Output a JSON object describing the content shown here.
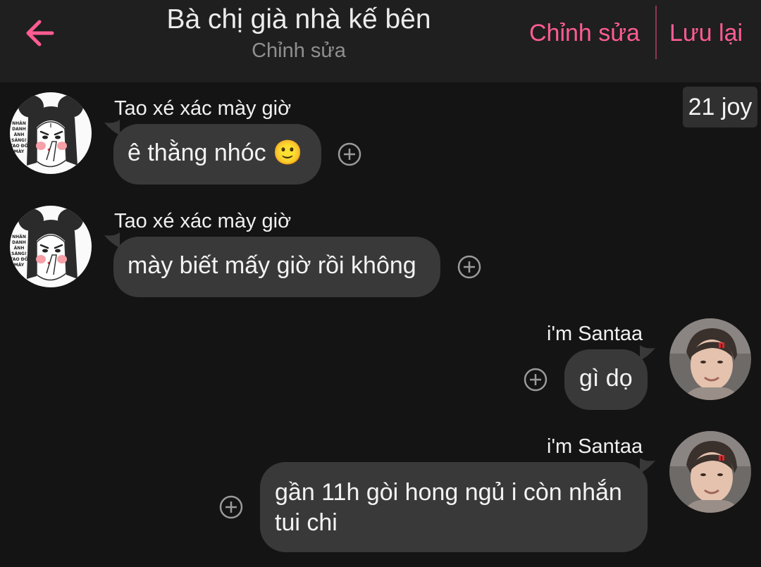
{
  "header": {
    "back_icon": "arrow-left-icon",
    "title": "Bà chị già nhà kế bên",
    "subtitle": "Chỉnh sửa",
    "edit_label": "Chỉnh sửa",
    "save_label": "Lưu lại"
  },
  "badge": {
    "text": "21 joy"
  },
  "messages": [
    {
      "sender": "Tao xé xác mày giờ",
      "text": "ê thằng nhóc 🙂"
    },
    {
      "sender": "Tao xé xác mày giờ",
      "text": "mày biết mấy giờ rồi không"
    },
    {
      "sender": "i'm Santaa",
      "text": "gì dọ"
    },
    {
      "sender": "i'm Santaa",
      "text_line1": "gần 11h gòi hong ngủ i còn nhắn",
      "text_line2": "tui chi"
    }
  ],
  "avatar_left": {
    "icon": "cartoon-girl-avatar",
    "caption_lines": [
      "NHÂN",
      "DANH",
      "ÁNH",
      "SÁNG!",
      "TAO ĐỒ",
      "MÀY"
    ]
  },
  "avatar_right": {
    "icon": "user-photo-avatar"
  },
  "colors": {
    "accent": "#ff5c93",
    "bubble": "#393939",
    "background": "#141414",
    "header": "#1f1f1f"
  }
}
